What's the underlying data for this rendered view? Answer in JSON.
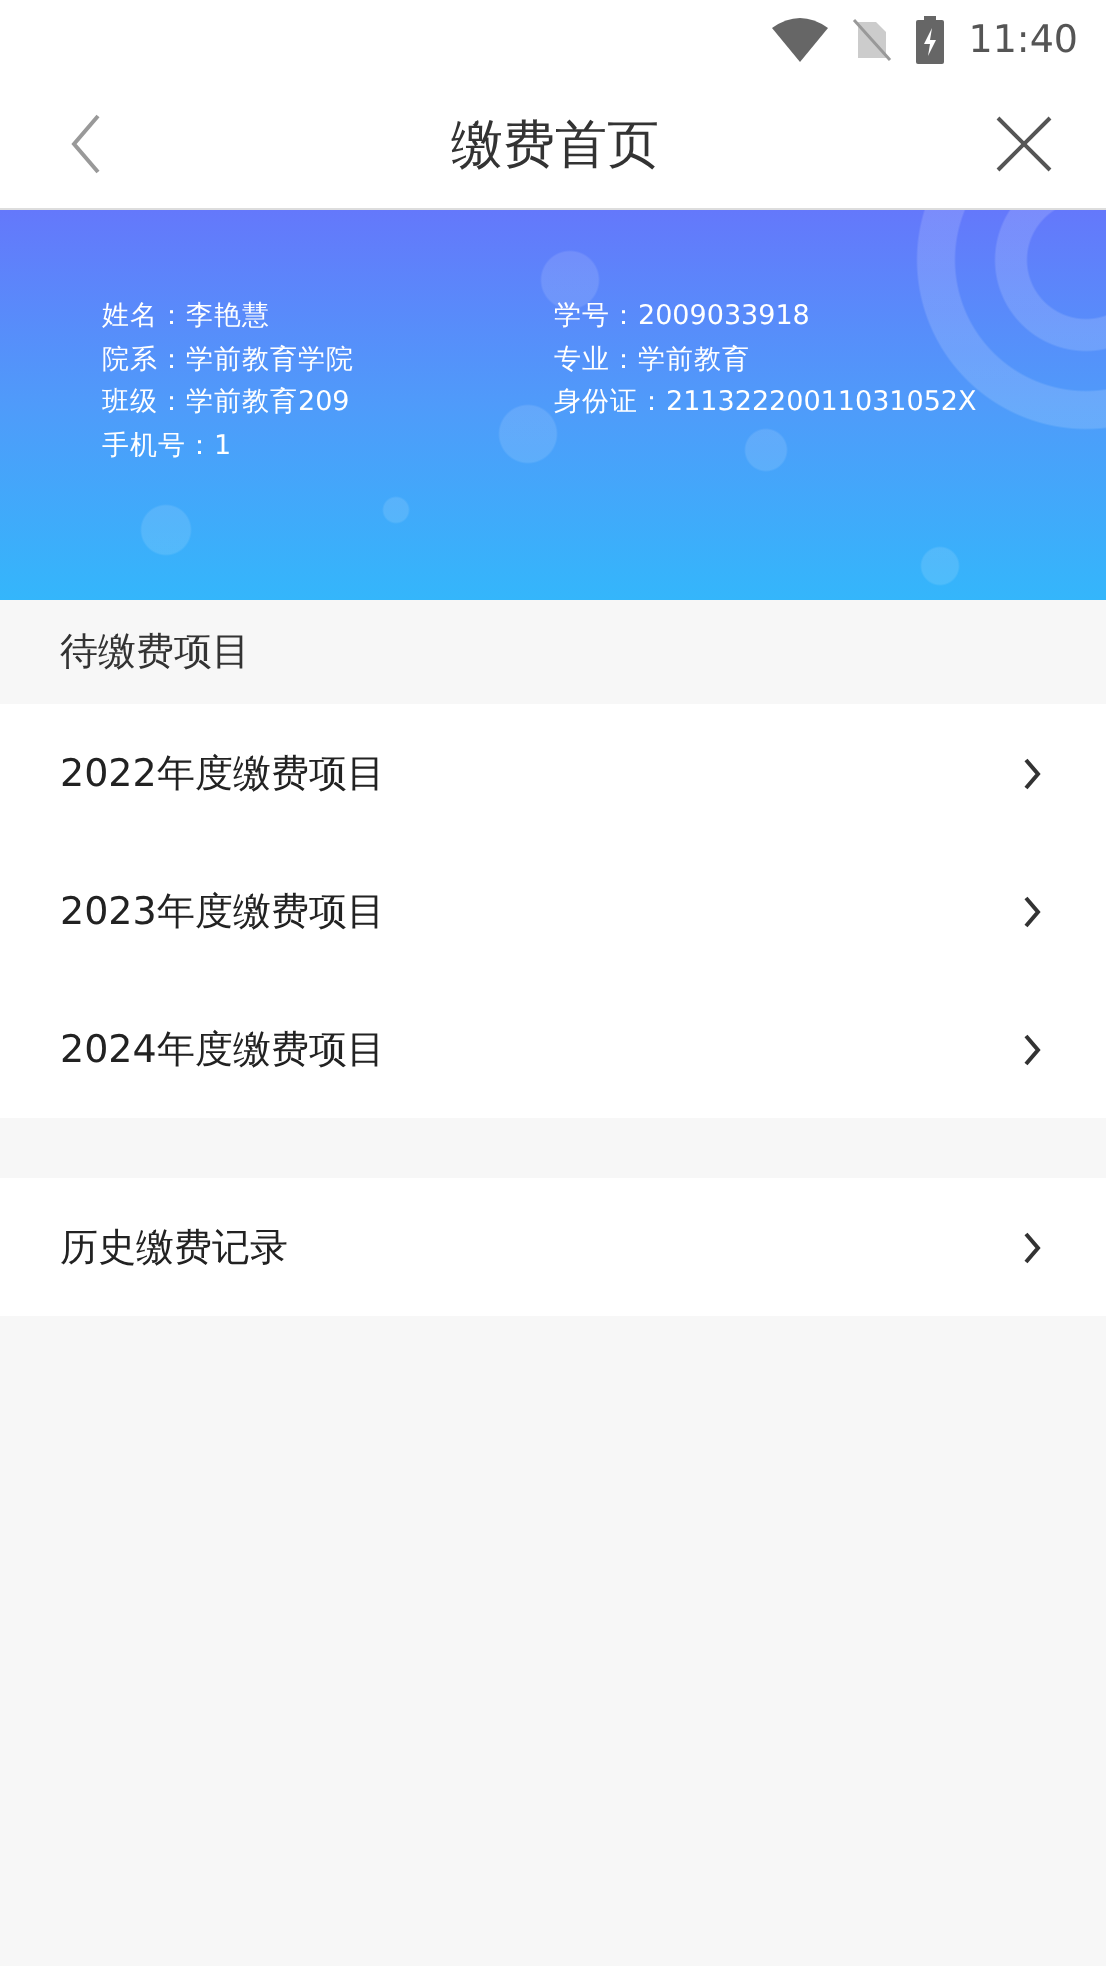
{
  "status_bar": {
    "time": "11:40"
  },
  "nav": {
    "title": "缴费首页"
  },
  "student": {
    "fields": [
      "姓名：李艳慧",
      "学号：2009033918",
      "院系：学前教育学院",
      "专业：学前教育",
      "班级：学前教育209",
      "身份证：21132220011031052X",
      "手机号：1"
    ]
  },
  "pending": {
    "title": "待缴费项目",
    "items": [
      {
        "label": "2022年度缴费项目"
      },
      {
        "label": "2023年度缴费项目"
      },
      {
        "label": "2024年度缴费项目"
      }
    ]
  },
  "history": {
    "items": [
      {
        "label": "历史缴费记录"
      }
    ]
  }
}
